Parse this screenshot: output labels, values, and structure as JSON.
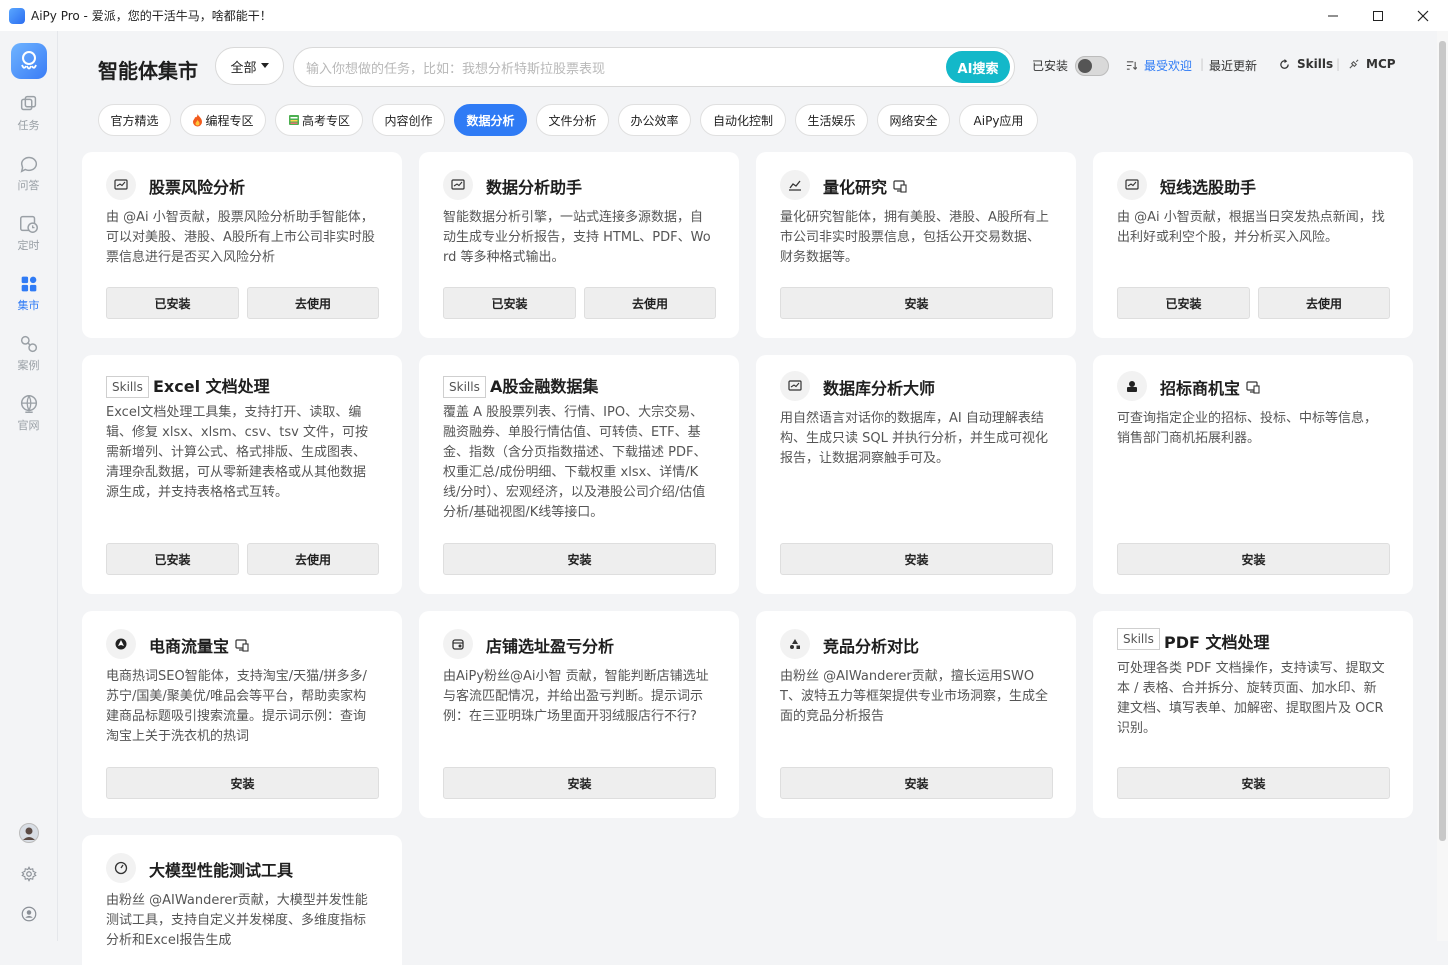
{
  "window": {
    "title": "AiPy Pro - 爱派，您的干活牛马，啥都能干！",
    "minimize": "—",
    "maximize": "☐",
    "close": "✕"
  },
  "sidebar": {
    "items": [
      {
        "label": "任务",
        "icon": "layers-icon"
      },
      {
        "label": "问答",
        "icon": "chat-icon"
      },
      {
        "label": "定时",
        "icon": "clock-icon"
      },
      {
        "label": "集市",
        "icon": "grid-icon",
        "active": true
      },
      {
        "label": "案例",
        "icon": "share-icon"
      },
      {
        "label": "官网",
        "icon": "globe-icon"
      }
    ]
  },
  "header": {
    "title": "智能体集市",
    "dropdown": "全部",
    "search_placeholder": "输入你想做的任务，比如：我想分析特斯拉股票表现",
    "ai_search": "AI搜索",
    "installed_label": "已安装",
    "sort_popular": "最受欢迎",
    "sort_recent": "最近更新",
    "skills": "Skills",
    "mcp": "MCP",
    "accent": "#2f7bf5",
    "ai_color": "#13b8c9"
  },
  "tabs": [
    {
      "label": "官方精选"
    },
    {
      "label": "编程专区",
      "icon": "fire-icon"
    },
    {
      "label": "高考专区",
      "icon": "book-icon"
    },
    {
      "label": "内容创作"
    },
    {
      "label": "数据分析",
      "active": true
    },
    {
      "label": "文件分析"
    },
    {
      "label": "办公效率"
    },
    {
      "label": "自动化控制"
    },
    {
      "label": "生活娱乐"
    },
    {
      "label": "网络安全"
    },
    {
      "label": "AiPy应用"
    }
  ],
  "cards": [
    {
      "title": "股票风险分析",
      "desc": "由 @Ai 小智贡献，股票风险分析助手智能体，可以对美股、港股、A股所有上市公司非实时股票信息进行是否买入风险分析",
      "buttons": [
        "已安装",
        "去使用"
      ]
    },
    {
      "title": "数据分析助手",
      "desc": "智能数据分析引擎，一站式连接多源数据，自动生成专业分析报告，支持 HTML、PDF、Word 等多种格式输出。",
      "buttons": [
        "已安装",
        "去使用"
      ]
    },
    {
      "title": "量化研究",
      "desc": "量化研究智能体，拥有美股、港股、A股所有上市公司非实时股票信息，包括公开交易数据、财务数据等。",
      "buttons": [
        "安装"
      ]
    },
    {
      "title": "短线选股助手",
      "desc": "由 @Ai 小智贡献，根据当日突发热点新闻，找出利好或利空个股，并分析买入风险。",
      "buttons": [
        "已安装",
        "去使用"
      ]
    },
    {
      "tag": "Skills",
      "title": "Excel 文档处理",
      "desc": "Excel文档处理工具集，支持打开、读取、编辑、修复 xlsx、xlsm、csv、tsv 文件，可按需新增列、计算公式、格式排版、生成图表、清理杂乱数据，可从零新建表格或从其他数据源生成，并支持表格格式互转。",
      "buttons": [
        "已安装",
        "去使用"
      ]
    },
    {
      "tag": "Skills",
      "title": "A股金融数据集",
      "desc": "覆盖 A 股股票列表、行情、IPO、大宗交易、融资融券、单股行情估值、可转债、ETF、基金、指数（含分页指数描述、下载描述 PDF、权重汇总/成份明细、下载权重 xlsx、详情/K 线/分时）、宏观经济，以及港股公司介绍/估值分析/基础视图/K线等接口。",
      "buttons": [
        "安装"
      ]
    },
    {
      "title": "数据库分析大师",
      "desc": "用自然语言对话你的数据库，AI 自动理解表结构、生成只读 SQL 并执行分析，并生成可视化报告，让数据洞察触手可及。",
      "buttons": [
        "安装"
      ]
    },
    {
      "title": "招标商机宝",
      "desc": "可查询指定企业的招标、投标、中标等信息，销售部门商机拓展利器。",
      "buttons": [
        "安装"
      ]
    },
    {
      "title": "电商流量宝",
      "desc": "电商热词SEO智能体，支持淘宝/天猫/拼多多/苏宁/国美/聚美优/唯品会等平台，帮助卖家构建商品标题吸引搜索流量。提示词示例：查询淘宝上关于洗衣机的热词",
      "buttons": [
        "安装"
      ]
    },
    {
      "title": "店铺选址盈亏分析",
      "desc": "由AiPy粉丝@Ai小智 贡献，智能判断店铺选址与客流匹配情况，并给出盈亏判断。提示词示例：在三亚明珠广场里面开羽绒服店行不行?",
      "buttons": [
        "安装"
      ]
    },
    {
      "title": "竞品分析对比",
      "desc": "由粉丝 @AIWanderer贡献，擅长运用SWOT、波特五力等框架提供专业市场洞察，生成全面的竞品分析报告",
      "buttons": [
        "安装"
      ]
    },
    {
      "tag": "Skills",
      "title": "PDF 文档处理",
      "desc": "可处理各类 PDF 文档操作，支持读写、提取文本 / 表格、合并拆分、旋转页面、加水印、新建文档、填写表单、加解密、提取图片及 OCR 识别。",
      "buttons": [
        "安装"
      ]
    },
    {
      "title": "大模型性能测试工具",
      "desc": "由粉丝 @AIWanderer贡献，大模型并发性能测试工具，支持自定义并发梯度、多维度指标分析和Excel报告生成",
      "buttons": []
    }
  ]
}
